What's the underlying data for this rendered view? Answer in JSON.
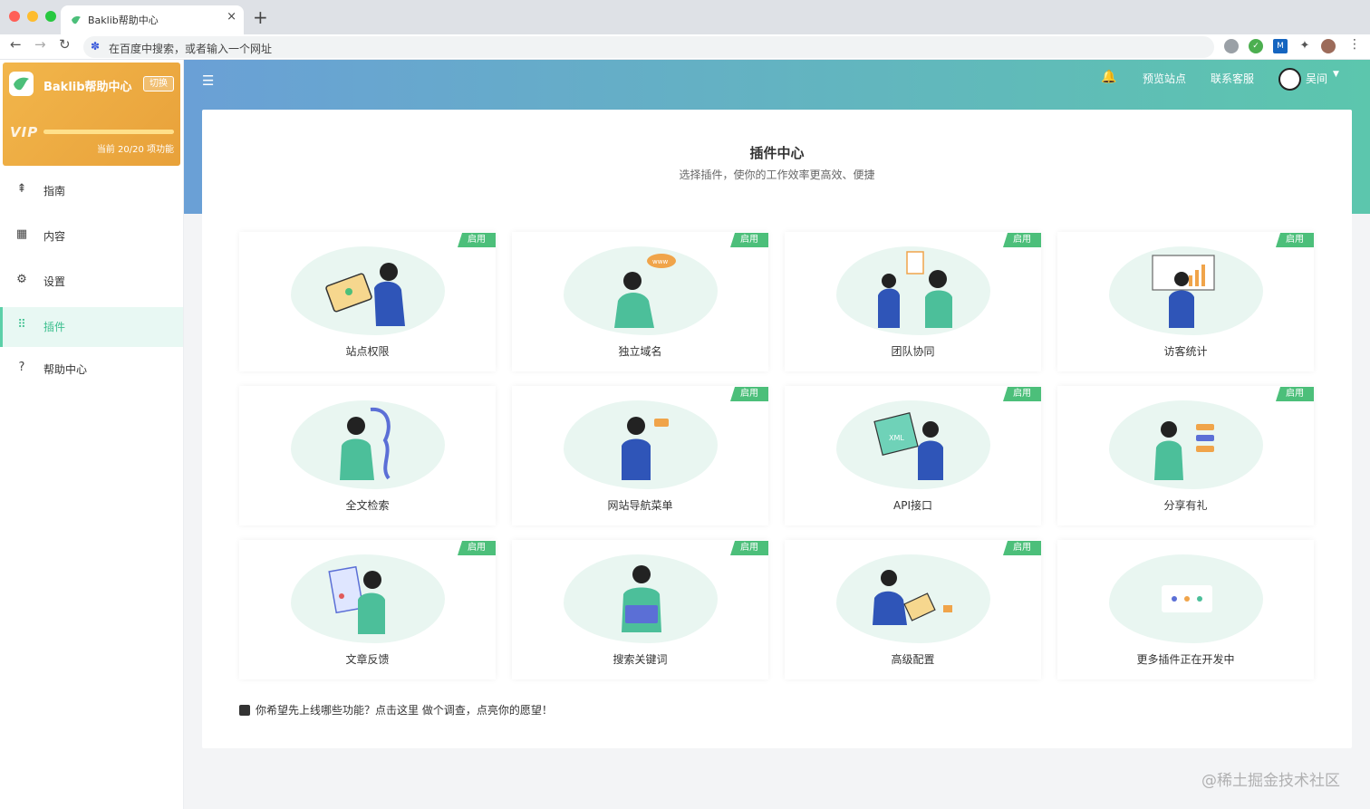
{
  "browser": {
    "tab_title": "Baklib帮助中心",
    "tab_close": "×",
    "new_tab": "+",
    "address_placeholder": "在百度中搜索，或者输入一个网址"
  },
  "sidebar": {
    "site_name": "Baklib帮助中心",
    "switch_label": "切换",
    "vip_label": "VIP",
    "vip_usage_fraction": 1.0,
    "vip_count": "当前 20/20 项功能",
    "items": [
      {
        "label": "指南",
        "icon": "guide-icon"
      },
      {
        "label": "内容",
        "icon": "content-grid-icon"
      },
      {
        "label": "设置",
        "icon": "gear-icon"
      },
      {
        "label": "插件",
        "icon": "plugin-grid-icon",
        "active": true
      },
      {
        "label": "帮助中心",
        "icon": "help-icon"
      }
    ]
  },
  "header": {
    "preview": "预览站点",
    "support": "联系客服",
    "user": "吴间"
  },
  "main": {
    "title": "插件中心",
    "subtitle": "选择插件，使你的工作效率更高效、便捷",
    "badge_label": "启用",
    "plugins": [
      {
        "name": "站点权限",
        "enabled": true
      },
      {
        "name": "独立域名",
        "enabled": true
      },
      {
        "name": "团队协同",
        "enabled": true
      },
      {
        "name": "访客统计",
        "enabled": true
      },
      {
        "name": "全文检索",
        "enabled": false
      },
      {
        "name": "网站导航菜单",
        "enabled": true
      },
      {
        "name": "API接口",
        "enabled": true
      },
      {
        "name": "分享有礼",
        "enabled": true
      },
      {
        "name": "文章反馈",
        "enabled": true
      },
      {
        "name": "搜索关键词",
        "enabled": true
      },
      {
        "name": "高级配置",
        "enabled": true
      },
      {
        "name": "更多插件正在开发中",
        "enabled": false
      }
    ],
    "survey": "你希望先上线哪些功能？点击这里 做个调查，点亮你的愿望！"
  },
  "watermark": "@稀土掘金技术社区",
  "colors": {
    "accent": "#3cbf8e",
    "badge": "#4cbf7a",
    "header_start": "#6aa0d6",
    "header_end": "#5cc6ad",
    "site_card": "#f2b64b"
  }
}
